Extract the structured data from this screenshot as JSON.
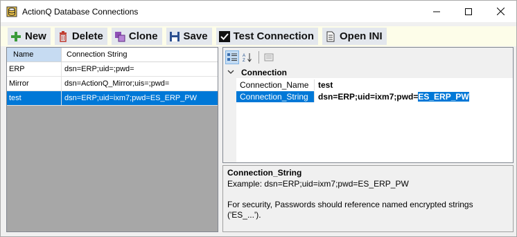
{
  "window": {
    "title": "ActionQ Database Connections"
  },
  "toolbar": {
    "new_label": "New",
    "delete_label": "Delete",
    "clone_label": "Clone",
    "save_label": "Save",
    "test_label": "Test Connection",
    "open_ini_label": "Open INI"
  },
  "grid": {
    "headers": {
      "name": "Name",
      "conn": "Connection String"
    },
    "rows": [
      {
        "name": "ERP",
        "conn": "dsn=ERP;uid=;pwd="
      },
      {
        "name": "Mirror",
        "conn": "dsn=ActionQ_Mirror;uis=;pwd="
      },
      {
        "name": "test",
        "conn": "dsn=ERP;uid=ixm7;pwd=ES_ERP_PW"
      }
    ]
  },
  "propertygrid": {
    "category": "Connection",
    "props": [
      {
        "name": "Connection_Name",
        "value": "test"
      },
      {
        "name": "Connection_String",
        "value_prefix": "dsn=ERP;uid=ixm7;pwd=",
        "value_selected": "ES_ERP_PW"
      }
    ]
  },
  "description": {
    "title": "Connection_String",
    "line1": "Example: dsn=ERP;uid=ixm7;pwd=ES_ERP_PW",
    "line2": "For security, Passwords should reference named encrypted strings",
    "line3": "('ES_...')."
  },
  "colors": {
    "selection": "#0078d7",
    "toolbar_bg": "#fdfde9",
    "header_selected": "#c6dbf2"
  }
}
